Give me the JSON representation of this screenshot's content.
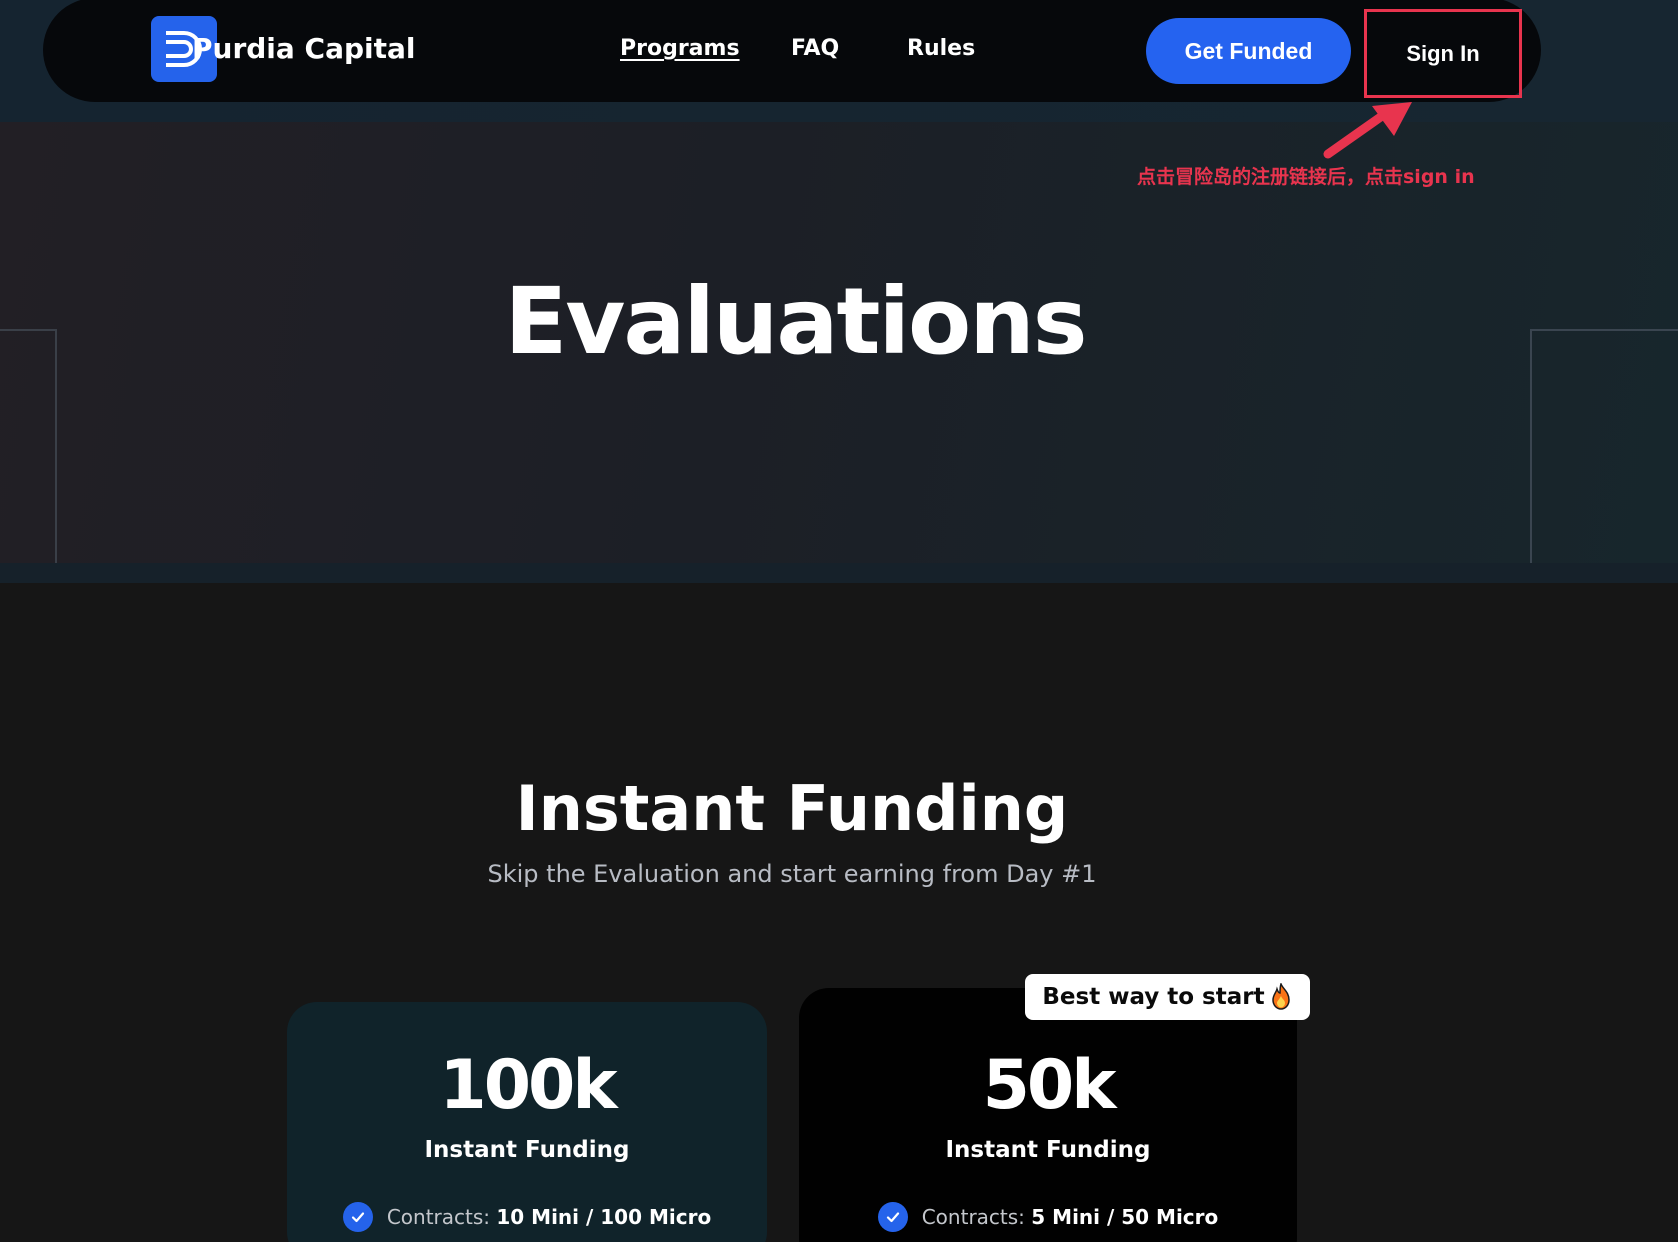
{
  "nav": {
    "brand": "Purdia Capital",
    "links": [
      {
        "label": "Programs"
      },
      {
        "label": "FAQ"
      },
      {
        "label": "Rules"
      }
    ],
    "get_funded_label": "Get Funded",
    "sign_in_label": "Sign In"
  },
  "annotation": {
    "text": "点击冒险岛的注册链接后，点击sign in",
    "color": "#e8344e"
  },
  "hero": {
    "title": "Evaluations"
  },
  "section": {
    "title": "Instant Funding",
    "subtitle": "Skip the Evaluation and start earning from Day #1"
  },
  "cards": [
    {
      "amount": "100k",
      "label": "Instant Funding",
      "feature_label": "Contracts:",
      "feature_value": "10 Mini / 100 Micro"
    },
    {
      "amount": "50k",
      "label": "Instant Funding",
      "feature_label": "Contracts:",
      "feature_value": "5 Mini / 50 Micro",
      "badge": "Best way to start",
      "badge_icon": "fire-icon"
    }
  ],
  "colors": {
    "accent": "#2563eb",
    "highlight": "#e8344e"
  }
}
